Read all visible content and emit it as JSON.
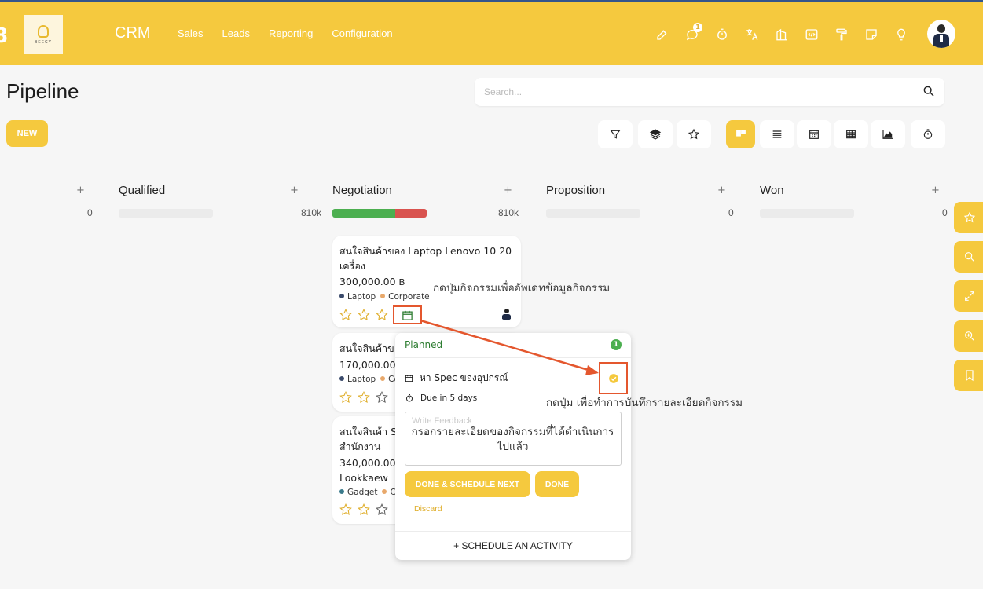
{
  "navbar": {
    "brand": "CRM",
    "logo_text": "BEECY",
    "menu": [
      "Sales",
      "Leads",
      "Reporting",
      "Configuration"
    ],
    "chat_badge": "1",
    "icons": [
      "edit-icon",
      "chat-icon",
      "stopwatch-icon",
      "translate-icon",
      "building-icon",
      "code-icon",
      "paint-roller-icon",
      "sticky-note-icon",
      "lightbulb-icon"
    ]
  },
  "page": {
    "title": "Pipeline",
    "search_placeholder": "Search...",
    "new_label": "NEW"
  },
  "columns": [
    {
      "title": "Qualified",
      "count_left": "0",
      "count": "0"
    },
    {
      "title": "Negotiation",
      "count": "810k",
      "progress": {
        "green": 0.67,
        "red": 0.33
      }
    },
    {
      "title": "Proposition",
      "count": "0"
    },
    {
      "title": "Won",
      "count": "0"
    }
  ],
  "cards": [
    {
      "title": "สนใจสินค้าของ Laptop Lenovo 10 20 เครื่อง",
      "amount": "300,000.00 ฿",
      "tags": [
        "Laptop",
        "Corporate"
      ]
    },
    {
      "title": "สนใจสินค้าข",
      "amount": "170,000.00",
      "tags": [
        "Laptop",
        "Co"
      ]
    },
    {
      "title": "สนใจสินค้า S",
      "title2": "สำนักงาน",
      "amount": "340,000.00",
      "customer": "Lookkaew",
      "tags": [
        "Gadget",
        "Co"
      ]
    }
  ],
  "popover": {
    "status": "Planned",
    "count": "1",
    "activity": "หา Spec ของอุปกรณ์",
    "due": "Due in 5 days",
    "feedback_placeholder": "Write Feedback",
    "done_schedule_label": "DONE & SCHEDULE NEXT",
    "done_label": "DONE",
    "discard_label": "Discard",
    "schedule_label": "+ SCHEDULE AN ACTIVITY"
  },
  "annotations": {
    "activity_button": "กดปุ่มกิจกรรมเพื่ออัพเดทข้อมูลกิจกรรม",
    "mark_done": "กดปุ่ม เพื่อทำการบันทึกรายละเอียดกิจกรรม",
    "feedback": "กรอกรายละเอียดของกิจกรรมที่ได้ดำเนินการไปแล้ว"
  },
  "colors": {
    "accent": "#f5c93e",
    "planned": "#2e7d32",
    "annotation_arrow": "#e4572e"
  }
}
